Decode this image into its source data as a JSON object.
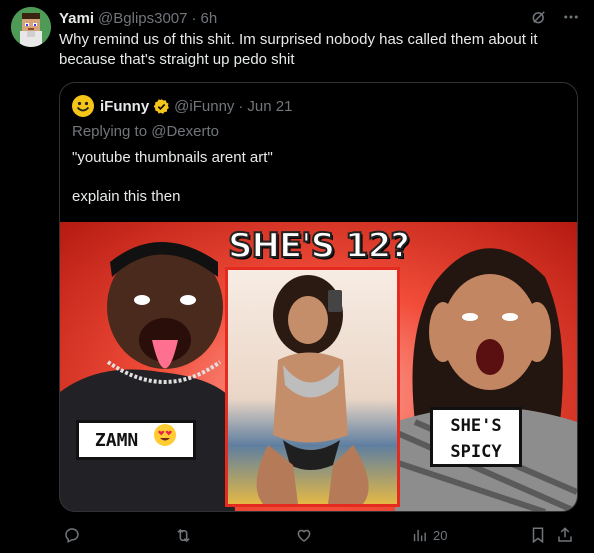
{
  "post": {
    "author_name": "Yami",
    "author_handle": "@Bglips3007",
    "separator": "·",
    "time": "6h",
    "text": "Why remind us of this shit. Im surprised nobody has called them about it because that's straight up pedo shit"
  },
  "quote": {
    "author_name": "iFunny",
    "author_handle": "@iFunny",
    "separator": "·",
    "date": "Jun 21",
    "replying_prefix": "Replying to",
    "replying_to": "@Dexerto",
    "text_line1": "\"youtube thumbnails arent art\"",
    "text_line2": "explain this then",
    "verified_color": "#f5c518"
  },
  "thumbnail": {
    "title": "SHE'S 12?",
    "caption_left": "ZAMN",
    "caption_right_line1": "SHE'S",
    "caption_right_line2": "SPICY"
  },
  "actions": {
    "views_count": "20"
  },
  "icons": [
    "grok-icon",
    "more-icon",
    "verified-badge-icon",
    "reply-icon",
    "retweet-icon",
    "like-icon",
    "views-icon",
    "bookmark-icon",
    "share-icon"
  ],
  "colors": {
    "background": "#000000",
    "text": "#e7e9ea",
    "muted": "#71767b",
    "border": "#2f3336",
    "thumb_red": "#e52b1f"
  }
}
